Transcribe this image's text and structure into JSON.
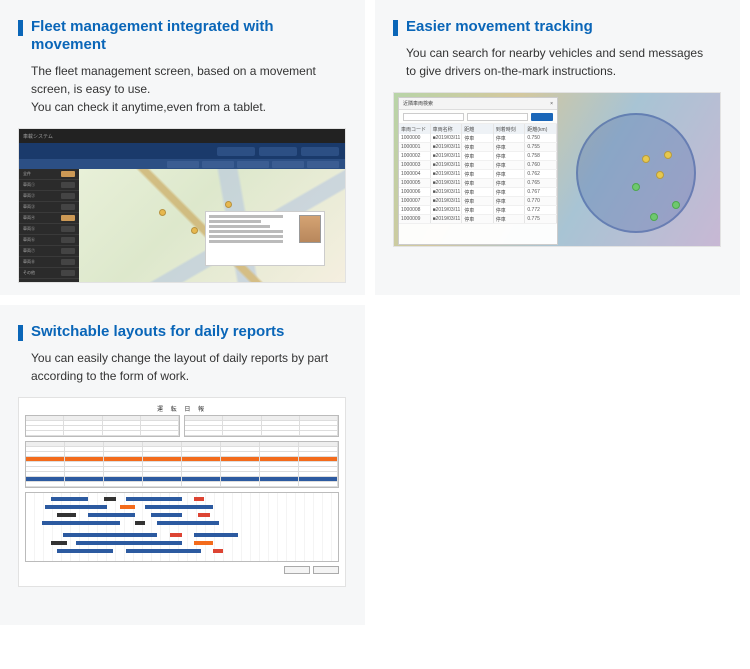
{
  "cards": {
    "fleet": {
      "title": "Fleet management integrated with movement",
      "desc": "The fleet management screen, based on a movement screen, is easy to use.\nYou can check it anytime,even from a tablet."
    },
    "tracking": {
      "title": "Easier movement tracking",
      "desc": "You can search for nearby vehicles and send messages to give drivers on-the-mark instructions."
    },
    "reports": {
      "title": "Switchable layouts for daily reports",
      "desc": "You can easily change the layout of daily reports by part according to the form of work."
    }
  },
  "shot1": {
    "sidebar_rows": [
      "全件",
      "車両①",
      "車両②",
      "車両③",
      "車両④",
      "車両⑤",
      "車両⑥",
      "車両⑦",
      "車両⑧",
      "その他"
    ]
  },
  "shot2": {
    "panel_title": "近隣車両検索",
    "cols": [
      "車両コード",
      "車両名称",
      "距離",
      "到着時刻",
      "距離(km)"
    ],
    "rows": [
      [
        "1000000",
        "■2019/03/11",
        "停車",
        "停車",
        "0.750"
      ],
      [
        "1000001",
        "■2019/03/11",
        "停車",
        "停車",
        "0.755"
      ],
      [
        "1000002",
        "■2019/03/11",
        "停車",
        "停車",
        "0.758"
      ],
      [
        "1000003",
        "■2019/03/11",
        "停車",
        "停車",
        "0.760"
      ],
      [
        "1000004",
        "■2019/03/11",
        "停車",
        "停車",
        "0.762"
      ],
      [
        "1000005",
        "■2019/03/11",
        "停車",
        "停車",
        "0.765"
      ],
      [
        "1000006",
        "■2019/03/11",
        "停車",
        "停車",
        "0.767"
      ],
      [
        "1000007",
        "■2019/03/11",
        "停車",
        "停車",
        "0.770"
      ],
      [
        "1000008",
        "■2019/03/11",
        "停車",
        "停車",
        "0.772"
      ],
      [
        "1000009",
        "■2019/03/11",
        "停車",
        "停車",
        "0.775"
      ]
    ]
  },
  "shot3": {
    "title": "運 転 日 報"
  }
}
